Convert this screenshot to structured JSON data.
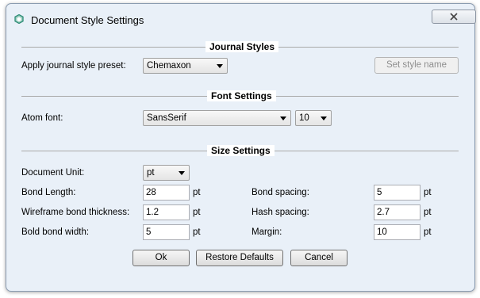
{
  "window": {
    "title": "Document Style Settings",
    "app_icon": "chemaxon-logo-icon"
  },
  "journal": {
    "section_title": "Journal Styles",
    "preset_label": "Apply journal style preset:",
    "preset_value": "Chemaxon",
    "set_name_label": "Set style name"
  },
  "font": {
    "section_title": "Font Settings",
    "atom_font_label": "Atom font:",
    "atom_font_value": "SansSerif",
    "size_value": "10"
  },
  "size": {
    "section_title": "Size Settings",
    "document_unit_label": "Document Unit:",
    "document_unit_value": "pt",
    "bond_length": {
      "label": "Bond Length:",
      "value": "28",
      "unit": "pt"
    },
    "wireframe": {
      "label": "Wireframe bond thickness:",
      "value": "1.2",
      "unit": "pt"
    },
    "bold_width": {
      "label": "Bold bond width:",
      "value": "5",
      "unit": "pt"
    },
    "bond_spacing": {
      "label": "Bond spacing:",
      "value": "5",
      "unit": "pt"
    },
    "hash_spacing": {
      "label": "Hash spacing:",
      "value": "2.7",
      "unit": "pt"
    },
    "margin": {
      "label": "Margin:",
      "value": "10",
      "unit": "pt"
    }
  },
  "buttons": {
    "ok": "Ok",
    "restore": "Restore Defaults",
    "cancel": "Cancel"
  },
  "colors": {
    "window_frame": "#e9f0f8",
    "close_hover": "#c75050"
  }
}
